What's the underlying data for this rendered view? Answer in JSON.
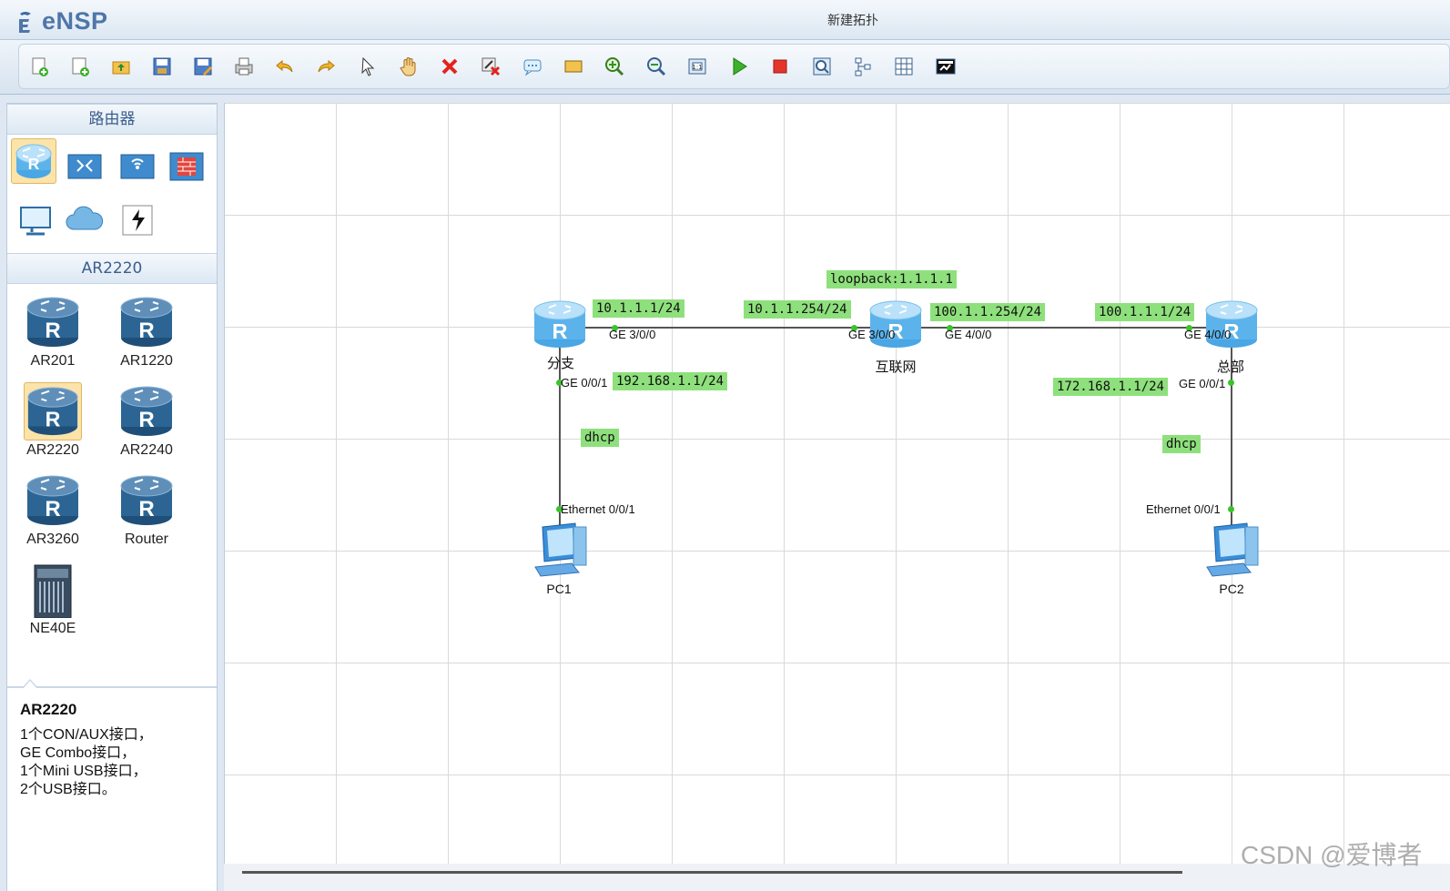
{
  "app": {
    "logo_text": "eNSP",
    "window_title": "新建拓扑"
  },
  "toolbar": {
    "buttons": [
      {
        "name": "new-topology-button",
        "icon": "new-file-icon"
      },
      {
        "name": "new-lab-button",
        "icon": "new-lab-icon"
      },
      {
        "name": "open-button",
        "icon": "open-folder-icon"
      },
      {
        "name": "save-button",
        "icon": "save-icon"
      },
      {
        "name": "save-as-button",
        "icon": "save-as-icon"
      },
      {
        "name": "print-button",
        "icon": "print-icon"
      },
      {
        "name": "undo-button",
        "icon": "undo-icon"
      },
      {
        "name": "redo-button",
        "icon": "redo-icon"
      },
      {
        "name": "select-button",
        "icon": "pointer-icon"
      },
      {
        "name": "pan-button",
        "icon": "hand-icon"
      },
      {
        "name": "delete-button",
        "icon": "delete-icon"
      },
      {
        "name": "delete-link-button",
        "icon": "delete-link-icon"
      },
      {
        "name": "text-note-button",
        "icon": "comment-icon"
      },
      {
        "name": "area-button",
        "icon": "rectangle-icon"
      },
      {
        "name": "zoom-in-button",
        "icon": "zoom-in-icon"
      },
      {
        "name": "zoom-out-button",
        "icon": "zoom-out-icon"
      },
      {
        "name": "fit-view-button",
        "icon": "fit-icon"
      },
      {
        "name": "start-devices-button",
        "icon": "play-icon"
      },
      {
        "name": "stop-devices-button",
        "icon": "stop-icon"
      },
      {
        "name": "capture-button",
        "icon": "capture-icon"
      },
      {
        "name": "topology-button",
        "icon": "topology-icon"
      },
      {
        "name": "grid-button",
        "icon": "grid-icon"
      },
      {
        "name": "console-button",
        "icon": "console-icon"
      }
    ]
  },
  "sidebar": {
    "category_title": "路由器",
    "categories": [
      {
        "icon": "router-category-icon",
        "selected": true
      },
      {
        "icon": "switch-category-icon",
        "selected": false
      },
      {
        "icon": "wireless-category-icon",
        "selected": false
      },
      {
        "icon": "firewall-category-icon",
        "selected": false
      },
      {
        "icon": "pc-category-icon",
        "selected": false
      },
      {
        "icon": "cloud-category-icon",
        "selected": false
      },
      {
        "icon": "cable-category-icon",
        "selected": false
      }
    ],
    "device_group_title": "AR2220",
    "devices": [
      {
        "label": "AR201",
        "icon": "router-icon",
        "selected": false
      },
      {
        "label": "AR1220",
        "icon": "router-icon",
        "selected": false
      },
      {
        "label": "AR2220",
        "icon": "router-icon",
        "selected": true
      },
      {
        "label": "AR2240",
        "icon": "router-icon",
        "selected": false
      },
      {
        "label": "AR3260",
        "icon": "router-icon",
        "selected": false
      },
      {
        "label": "Router",
        "icon": "router-icon",
        "selected": false
      },
      {
        "label": "NE40E",
        "icon": "chassis-icon",
        "selected": false
      }
    ],
    "info": {
      "title": "AR2220",
      "lines": [
        "1个CON/AUX接口，",
        "GE Combo接口，",
        "1个Mini USB接口，",
        "2个USB接口。"
      ]
    }
  },
  "topology": {
    "nodes": [
      {
        "id": "branch",
        "name": "分支",
        "type": "router"
      },
      {
        "id": "internet",
        "name": "互联网",
        "type": "router"
      },
      {
        "id": "hq",
        "name": "总部",
        "type": "router"
      },
      {
        "id": "pc1",
        "name": "PC1",
        "type": "pc"
      },
      {
        "id": "pc2",
        "name": "PC2",
        "type": "pc"
      }
    ],
    "tags": {
      "loopback": "loopback:1.1.1.1",
      "branch_ge300": "10.1.1.1/24",
      "internet_ge300": "10.1.1.254/24",
      "internet_ge400": "100.1.1.254/24",
      "hq_ge400": "100.1.1.1/24",
      "branch_ge001": "192.168.1.1/24",
      "hq_ge001": "172.168.1.1/24",
      "dhcp_left": "dhcp",
      "dhcp_right": "dhcp"
    },
    "ports": {
      "branch_ge300": "GE 3/0/0",
      "internet_ge300": "GE 3/0/0",
      "internet_ge400": "GE 4/0/0",
      "hq_ge400": "GE 4/0/0",
      "branch_ge001": "GE 0/0/1",
      "hq_ge001": "GE 0/0/1",
      "pc1_eth": "Ethernet 0/0/1",
      "pc2_eth": "Ethernet 0/0/1"
    }
  },
  "watermark": "CSDN @爱博者"
}
